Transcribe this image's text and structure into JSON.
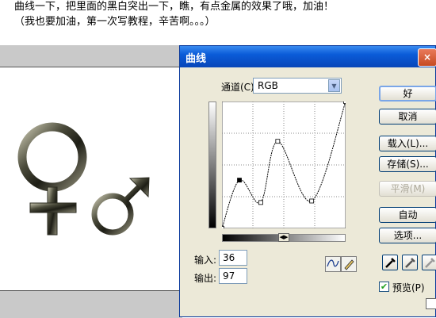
{
  "caption": {
    "line1": "曲线一下，把里面的黑白突出一下，瞧，有点金属的效果了哦，加油！",
    "line2": "（我也要加油，第一次写教程，辛苦啊。。。）"
  },
  "dialog": {
    "title": "曲线",
    "close_label": "×",
    "channel_label": "通道(C):",
    "channel_value": "RGB",
    "input_label": "输入:",
    "input_value": "36",
    "output_label": "输出:",
    "output_value": "97",
    "buttons": {
      "ok": "好",
      "cancel": "取消",
      "load": "载入(L)...",
      "save": "存储(S)...",
      "smooth": "平滑(M)",
      "auto": "自动",
      "options": "选项..."
    },
    "preview_label": "预览(P)",
    "preview_checked": true
  },
  "curve": {
    "range": [
      0,
      255
    ],
    "grid_divisions": 4,
    "points": [
      [
        0,
        0
      ],
      [
        36,
        97
      ],
      [
        80,
        52
      ],
      [
        115,
        175
      ],
      [
        185,
        55
      ],
      [
        255,
        255
      ]
    ],
    "active_point": [
      36,
      97
    ]
  }
}
